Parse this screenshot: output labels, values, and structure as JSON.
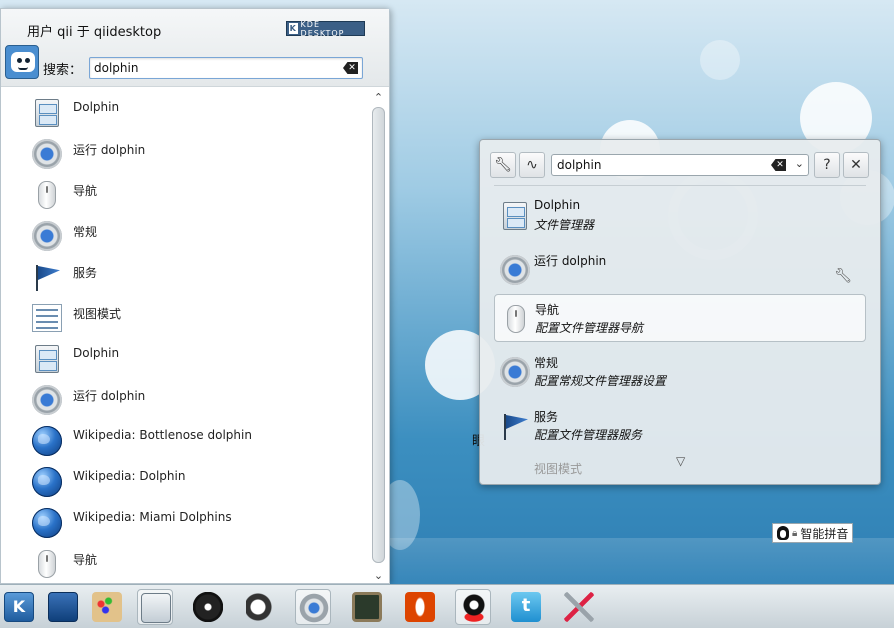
{
  "launcher": {
    "user_line": "用户 qii 于 qiidesktop",
    "badge_k": "K",
    "badge_text": "KDE DESKTOP",
    "search_label": "搜索：",
    "search_value": "dolphin",
    "results": [
      {
        "label": "Dolphin",
        "icon": "file-cabinet-icon"
      },
      {
        "label": "运行 dolphin",
        "icon": "gear-icon"
      },
      {
        "label": "导航",
        "icon": "mouse-icon"
      },
      {
        "label": "常规",
        "icon": "gear-icon"
      },
      {
        "label": "服务",
        "icon": "flag-icon"
      },
      {
        "label": "视图模式",
        "icon": "list-view-icon"
      },
      {
        "label": "Dolphin",
        "icon": "file-cabinet-icon"
      },
      {
        "label": "运行 dolphin",
        "icon": "gear-icon"
      },
      {
        "label": "Wikipedia: Bottlenose dolphin",
        "icon": "globe-icon"
      },
      {
        "label": "Wikipedia: Dolphin",
        "icon": "globe-icon"
      },
      {
        "label": "Wikipedia: Miami Dolphins",
        "icon": "globe-icon"
      },
      {
        "label": "导航",
        "icon": "mouse-icon"
      }
    ]
  },
  "krunner": {
    "search_value": "dolphin",
    "help_label": "?",
    "close_label": "✕",
    "items": [
      {
        "title": "Dolphin",
        "subtitle": "文件管理器",
        "icon": "file-cabinet-icon"
      },
      {
        "title": "运行 dolphin",
        "subtitle": "",
        "icon": "gear-icon"
      },
      {
        "title": "导航",
        "subtitle": "配置文件管理器导航",
        "icon": "mouse-icon"
      },
      {
        "title": "常规",
        "subtitle": "配置常规文件管理器设置",
        "icon": "gear-icon"
      },
      {
        "title": "服务",
        "subtitle": "配置文件管理器服务",
        "icon": "flag-icon"
      }
    ],
    "faded_item": "视图模式",
    "more_arrow": "▽"
  },
  "ime": {
    "label": "智能拼音"
  },
  "desktop_text": "眼",
  "taskbar": [
    "kde-menu-icon",
    "desktop-icon",
    "palette-icon",
    "file-manager-icon",
    "media-reel-icon",
    "announce-icon",
    "settings-gear-icon",
    "system-monitor-icon",
    "opera-icon",
    "qq-icon",
    "twitter-icon",
    "tools-icon"
  ]
}
